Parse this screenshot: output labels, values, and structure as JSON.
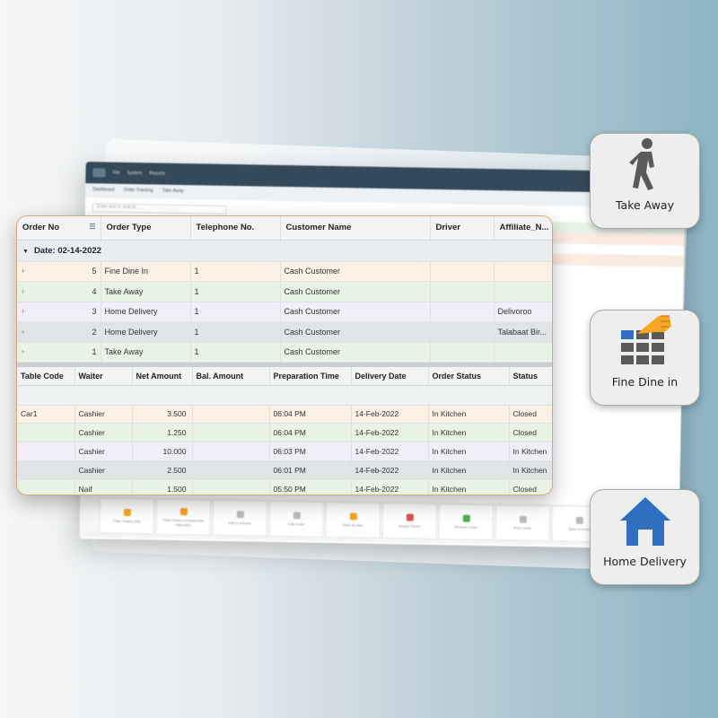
{
  "colors": {
    "accent_orange": "#f5a623",
    "accent_blue": "#2f6fbf",
    "card_border": "#d9a870",
    "icon_gray": "#5a5a5a"
  },
  "background_app": {
    "menu": [
      "File",
      "System",
      "Reports"
    ],
    "tabs": [
      "Dashboard",
      "Order Tracking",
      "Take Away"
    ],
    "search_placeholder": "Enter text to search...",
    "toolbar": [
      {
        "label": "Filter Orders (All)",
        "icon": "filter-icon",
        "color": "#f5a623"
      },
      {
        "label": "Filter Orders (Closed and Rejected)",
        "icon": "filter-icon",
        "color": "#f5a623"
      },
      {
        "label": "Edit in Kitchen",
        "icon": "edit-icon",
        "color": "#bbbbbb"
      },
      {
        "label": "Edit Order",
        "icon": "pencil-icon",
        "color": "#bbbbbb"
      },
      {
        "label": "Filter by date",
        "icon": "filter-icon",
        "color": "#f5a623"
      },
      {
        "label": "Assign Driver",
        "icon": "car-icon",
        "color": "#e15050"
      },
      {
        "label": "Receive Cash",
        "icon": "cash-icon",
        "color": "#4caf50"
      },
      {
        "label": "Print Order",
        "icon": "printer-icon",
        "color": "#bbbbbb"
      },
      {
        "label": "Save in Excel",
        "icon": "save-icon",
        "color": "#bbbbbb"
      }
    ]
  },
  "orders_table": {
    "columns": [
      "Order No",
      "Order Type",
      "Telephone No.",
      "Customer Name",
      "Driver",
      "Affiliate_N..."
    ],
    "group_label": "Date: 02-14-2022",
    "rows": [
      {
        "no": "5",
        "type": "Fine Dine In",
        "phone": "1",
        "customer": "Cash Customer",
        "driver": "",
        "affiliate": "",
        "tint": "orange"
      },
      {
        "no": "4",
        "type": "Take Away",
        "phone": "1",
        "customer": "Cash Customer",
        "driver": "",
        "affiliate": "",
        "tint": "green"
      },
      {
        "no": "3",
        "type": "Home Delivery",
        "phone": "1",
        "customer": "Cash Customer",
        "driver": "",
        "affiliate": "Delivoroo",
        "tint": "purple"
      },
      {
        "no": "2",
        "type": "Home Delivery",
        "phone": "1",
        "customer": "Cash Customer",
        "driver": "",
        "affiliate": "Talabaat Bir...",
        "tint": "gray"
      },
      {
        "no": "1",
        "type": "Take Away",
        "phone": "1",
        "customer": "Cash Customer",
        "driver": "",
        "affiliate": "",
        "tint": "green"
      }
    ]
  },
  "details_table": {
    "columns": [
      "Table Code",
      "Waiter",
      "Net Amount",
      "Bal. Amount",
      "Preparation Time",
      "Delivery Date",
      "Order Status",
      "Status"
    ],
    "rows": [
      {
        "table": "Car1",
        "waiter": "Cashier",
        "net": "3.500",
        "bal": "",
        "prep": "06:04 PM",
        "date": "14-Feb-2022",
        "order_status": "In Kitchen",
        "status": "Closed",
        "tint": "orange"
      },
      {
        "table": "",
        "waiter": "Cashier",
        "net": "1.250",
        "bal": "",
        "prep": "06:04 PM",
        "date": "14-Feb-2022",
        "order_status": "In Kitchen",
        "status": "Closed",
        "tint": "green"
      },
      {
        "table": "",
        "waiter": "Cashier",
        "net": "10.000",
        "bal": "",
        "prep": "06:03 PM",
        "date": "14-Feb-2022",
        "order_status": "In Kitchen",
        "status": "In Kitchen",
        "tint": "purple"
      },
      {
        "table": "",
        "waiter": "Cashier",
        "net": "2.500",
        "bal": "",
        "prep": "06:01 PM",
        "date": "14-Feb-2022",
        "order_status": "In Kitchen",
        "status": "In Kitchen",
        "tint": "gray"
      },
      {
        "table": "",
        "waiter": "Naif",
        "net": "1.500",
        "bal": "",
        "prep": "05:50 PM",
        "date": "14-Feb-2022",
        "order_status": "In Kitchen",
        "status": "Closed",
        "tint": "green"
      }
    ]
  },
  "badges": [
    {
      "label": "Take Away",
      "icon": "walking-person-icon"
    },
    {
      "label": "Fine Dine in",
      "icon": "table-grid-hand-icon"
    },
    {
      "label": "Home Delivery",
      "icon": "house-icon"
    }
  ]
}
